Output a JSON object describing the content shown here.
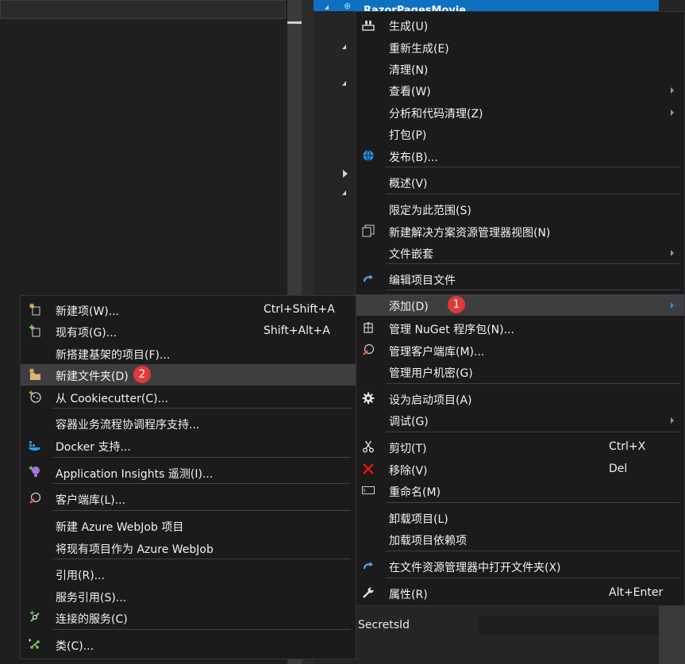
{
  "background": {
    "project_name": "RazorPagesMovie",
    "properties_row_label": "SecretsId"
  },
  "context_menu": {
    "items": [
      {
        "label": "生成(U)",
        "icon": "build-icon"
      },
      {
        "label": "重新生成(E)"
      },
      {
        "label": "清理(N)"
      },
      {
        "label": "查看(W)",
        "submenu": true
      },
      {
        "label": "分析和代码清理(Z)",
        "submenu": true
      },
      {
        "label": "打包(P)"
      },
      {
        "label": "发布(B)...",
        "icon": "globe-icon"
      },
      {
        "label": "概述(V)"
      },
      {
        "label": "限定为此范围(S)"
      },
      {
        "label": "新建解决方案资源管理器视图(N)",
        "icon": "new-view-icon"
      },
      {
        "label": "文件嵌套",
        "submenu": true
      },
      {
        "label": "编辑项目文件",
        "icon": "redo-arrow-icon"
      },
      {
        "label": "添加(D)",
        "submenu": true,
        "highlighted": true,
        "badge": "1"
      },
      {
        "label": "管理 NuGet 程序包(N)...",
        "icon": "nuget-icon"
      },
      {
        "label": "管理客户端库(M)...",
        "icon": "client-library-icon"
      },
      {
        "label": "管理用户机密(G)"
      },
      {
        "label": "设为启动项目(A)",
        "icon": "gear-icon"
      },
      {
        "label": "调试(G)",
        "submenu": true
      },
      {
        "label": "剪切(T)",
        "shortcut": "Ctrl+X",
        "icon": "scissors-icon"
      },
      {
        "label": "移除(V)",
        "shortcut": "Del",
        "icon": "red-x-icon"
      },
      {
        "label": "重命名(M)",
        "icon": "rename-icon"
      },
      {
        "label": "卸载项目(L)"
      },
      {
        "label": "加载项目依赖项"
      },
      {
        "label": "在文件资源管理器中打开文件夹(X)",
        "icon": "redo-arrow-icon"
      },
      {
        "label": "属性(R)",
        "shortcut": "Alt+Enter",
        "icon": "wrench-icon"
      }
    ]
  },
  "add_submenu": {
    "items": [
      {
        "label": "新建项(W)...",
        "shortcut": "Ctrl+Shift+A",
        "icon": "new-item-icon"
      },
      {
        "label": "现有项(G)...",
        "shortcut": "Shift+Alt+A",
        "icon": "existing-item-icon"
      },
      {
        "label": "新搭建基架的项目(F)..."
      },
      {
        "label": "新建文件夹(D)",
        "icon": "new-folder-icon",
        "highlighted": true,
        "badge": "2"
      },
      {
        "label": "从 Cookiecutter(C)...",
        "icon": "cookiecutter-icon"
      },
      {
        "label": "容器业务流程协调程序支持..."
      },
      {
        "label": "Docker 支持...",
        "icon": "docker-icon"
      },
      {
        "label": "Application Insights 遥测(I)...",
        "icon": "lightbulb-icon"
      },
      {
        "label": "客户端库(L)...",
        "icon": "client-library-icon"
      },
      {
        "label": "新建 Azure WebJob 项目"
      },
      {
        "label": "将现有项目作为 Azure WebJob"
      },
      {
        "label": "引用(R)..."
      },
      {
        "label": "服务引用(S)..."
      },
      {
        "label": "连接的服务(C)",
        "icon": "connected-service-icon"
      },
      {
        "label": "类(C)...",
        "icon": "class-icon"
      }
    ]
  },
  "colors": {
    "accent": "#0e70c0",
    "badge": "#e2383b",
    "menu_bg": "#1b1b1c",
    "highlight": "#3e3e40"
  }
}
